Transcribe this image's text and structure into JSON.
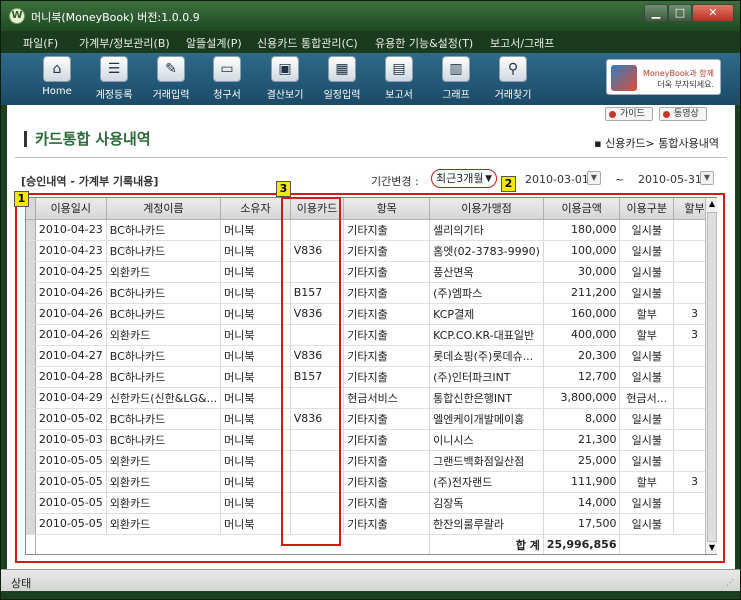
{
  "window": {
    "title": "머니북(MoneyBook) 버전:1.0.0.9",
    "app_icon_letter": "W"
  },
  "menubar": [
    "파일(F)",
    "가계부/정보관리(B)",
    "알뜰설계(P)",
    "신용카드 통합관리(C)",
    "유용한 기능&설정(T)",
    "보고서/그래프"
  ],
  "toolbar": [
    {
      "label": "Home",
      "icon": "home-icon"
    },
    {
      "label": "계정등록",
      "icon": "account-icon"
    },
    {
      "label": "거래입력",
      "icon": "edit-icon"
    },
    {
      "label": "청구서",
      "icon": "card-icon"
    },
    {
      "label": "결산보기",
      "icon": "monitor-icon"
    },
    {
      "label": "일정입력",
      "icon": "calendar-icon"
    },
    {
      "label": "보고서",
      "icon": "report-icon"
    },
    {
      "label": "그래프",
      "icon": "chart-icon"
    },
    {
      "label": "거래찾기",
      "icon": "search-icon"
    }
  ],
  "banner": {
    "line1": "MoneyBook과 함께",
    "line2": "더욱 부자되세요."
  },
  "top_buttons": {
    "guide": "가이드",
    "video": "동영상"
  },
  "page": {
    "title": "카드통합 사용내역",
    "breadcrumb": "▪ 신용카드> 통합사용내역",
    "sub_header": "[승인내역 - 가계부 기록내용]",
    "period_label": "기간변경 :",
    "period_value": "최근3개월",
    "date_from": "2010-03-01",
    "tilde": "~",
    "date_to": "2010-05-31"
  },
  "markers": {
    "m1": "1",
    "m2": "2",
    "m3": "3"
  },
  "table": {
    "headers": [
      "이용일시",
      "계정이름",
      "소유자",
      "이용카드",
      "항목",
      "이용가맹점",
      "이용금액",
      "이용구분",
      "할부"
    ],
    "rows": [
      [
        "2010-04-23",
        "BC하나카드",
        "머니북",
        "",
        "기타지출",
        "셀리의기타",
        "180,000",
        "일시불",
        ""
      ],
      [
        "2010-04-23",
        "BC하나카드",
        "머니북",
        "V836",
        "기타지출",
        "홈엣(02-3783-9990)",
        "100,000",
        "일시불",
        ""
      ],
      [
        "2010-04-25",
        "외환카드",
        "머니북",
        "",
        "기타지출",
        "풍산면옥",
        "30,000",
        "일시불",
        ""
      ],
      [
        "2010-04-26",
        "BC하나카드",
        "머니북",
        "B157",
        "기타지출",
        "(주)엠파스",
        "211,200",
        "일시불",
        ""
      ],
      [
        "2010-04-26",
        "BC하나카드",
        "머니북",
        "V836",
        "기타지출",
        "KCP결제",
        "160,000",
        "할부",
        "3"
      ],
      [
        "2010-04-26",
        "외환카드",
        "머니북",
        "",
        "기타지출",
        "KCP.CO.KR-대표일반",
        "400,000",
        "할부",
        "3"
      ],
      [
        "2010-04-27",
        "BC하나카드",
        "머니북",
        "V836",
        "기타지출",
        "롯데쇼핑(주)롯데슈...",
        "20,300",
        "일시불",
        ""
      ],
      [
        "2010-04-28",
        "BC하나카드",
        "머니북",
        "B157",
        "기타지출",
        "(주)인터파크INT",
        "12,700",
        "일시불",
        ""
      ],
      [
        "2010-04-29",
        "신한카드(신한&LG&...",
        "머니북",
        "",
        "현금서비스",
        "통합신한은행INT",
        "3,800,000",
        "현금서...",
        ""
      ],
      [
        "2010-05-02",
        "BC하나카드",
        "머니북",
        "V836",
        "기타지출",
        "엘엔케이개발메이홍",
        "8,000",
        "일시불",
        ""
      ],
      [
        "2010-05-03",
        "BC하나카드",
        "머니북",
        "",
        "기타지출",
        "이니시스",
        "21,300",
        "일시불",
        ""
      ],
      [
        "2010-05-05",
        "외환카드",
        "머니북",
        "",
        "기타지출",
        "그랜드백화점일산점",
        "25,000",
        "일시불",
        ""
      ],
      [
        "2010-05-05",
        "외환카드",
        "머니북",
        "",
        "기타지출",
        "(주)전자랜드",
        "111,900",
        "할부",
        "3"
      ],
      [
        "2010-05-05",
        "외환카드",
        "머니북",
        "",
        "기타지출",
        "김장독",
        "14,000",
        "일시불",
        ""
      ],
      [
        "2010-05-05",
        "외환카드",
        "머니북",
        "",
        "기타지출",
        "한잔의룰루랄라",
        "17,500",
        "일시불",
        ""
      ]
    ],
    "total_label": "합 계",
    "total_value": "25,996,856"
  },
  "status": {
    "text": "상태"
  },
  "colors": {
    "accent_green": "#2d6a3a",
    "highlight_red": "#d01a1a",
    "marker_yellow": "#f5e60a"
  }
}
